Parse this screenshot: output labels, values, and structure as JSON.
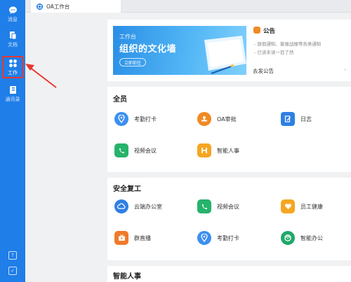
{
  "sidebar": {
    "items": [
      {
        "label": "消息",
        "icon": "chat-icon"
      },
      {
        "label": "文档",
        "icon": "document-icon"
      },
      {
        "label": "工作",
        "icon": "grid-icon"
      },
      {
        "label": "通讯录",
        "icon": "contacts-icon"
      }
    ],
    "bottom": [
      {
        "icon": "help-icon",
        "glyph": "?"
      },
      {
        "icon": "checkbox-icon",
        "glyph": "✓"
      }
    ]
  },
  "tab": {
    "label": "OA工作台"
  },
  "banner": {
    "subtitle": "工作台",
    "title": "组织的文化墙",
    "button": "立即前往"
  },
  "notice": {
    "title": "公告",
    "lines": [
      "- 放假通知、客报战报等各类通知",
      "- 已读未读一目了然"
    ],
    "link": "去发公告",
    "arrow": "›"
  },
  "sections": [
    {
      "title": "全员",
      "apps": [
        {
          "label": "考勤打卡",
          "icon": "location-icon",
          "color": "#3d8ff0"
        },
        {
          "label": "OA审批",
          "icon": "stamp-icon",
          "color": "#f08a24"
        },
        {
          "label": "日志",
          "icon": "log-icon",
          "color": "#2f7fe3"
        },
        {
          "label": "视频会议",
          "icon": "video-call-icon",
          "color": "#26b36b"
        },
        {
          "label": "智能人事",
          "icon": "hr-icon",
          "color": "#f5a623"
        }
      ]
    },
    {
      "title": "安全复工",
      "apps": [
        {
          "label": "云端办公室",
          "icon": "cloud-office-icon",
          "color": "#2f7fe3"
        },
        {
          "label": "视频会议",
          "icon": "video-call-icon",
          "color": "#26b36b"
        },
        {
          "label": "员工健康",
          "icon": "heart-icon",
          "color": "#f5a623"
        },
        {
          "label": "群直播",
          "icon": "live-icon",
          "color": "#f07a2a"
        },
        {
          "label": "考勤打卡",
          "icon": "location-icon",
          "color": "#3d8ff0"
        },
        {
          "label": "智能办公",
          "icon": "smart-office-icon",
          "color": "#1fa868"
        }
      ]
    },
    {
      "title": "智能人事",
      "apps": []
    }
  ],
  "colors": {
    "sidebar": "#1f7ee8",
    "highlight": "#e8372f"
  }
}
